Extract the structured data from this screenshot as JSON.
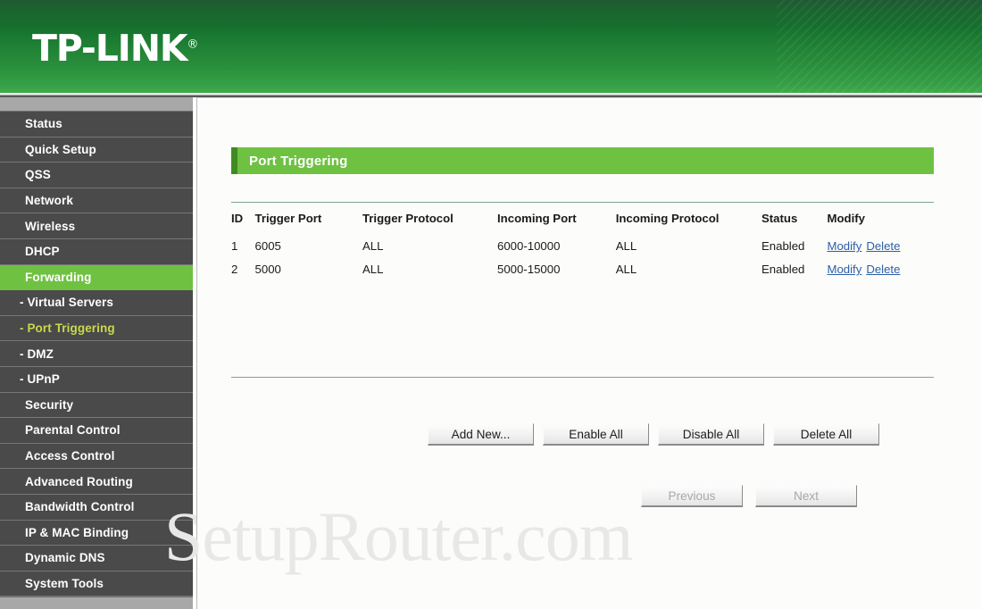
{
  "header": {
    "logo_text": "TP-LINK",
    "logo_registered": "®"
  },
  "sidebar": {
    "items": [
      {
        "label": "Status",
        "state": "normal"
      },
      {
        "label": "Quick Setup",
        "state": "normal"
      },
      {
        "label": "QSS",
        "state": "normal"
      },
      {
        "label": "Network",
        "state": "normal"
      },
      {
        "label": "Wireless",
        "state": "normal"
      },
      {
        "label": "DHCP",
        "state": "normal"
      },
      {
        "label": "Forwarding",
        "state": "active"
      },
      {
        "label": "- Virtual Servers",
        "state": "sub"
      },
      {
        "label": "- Port Triggering",
        "state": "current"
      },
      {
        "label": "- DMZ",
        "state": "sub"
      },
      {
        "label": "- UPnP",
        "state": "sub"
      },
      {
        "label": "Security",
        "state": "normal"
      },
      {
        "label": "Parental Control",
        "state": "normal"
      },
      {
        "label": "Access Control",
        "state": "normal"
      },
      {
        "label": "Advanced Routing",
        "state": "normal"
      },
      {
        "label": "Bandwidth Control",
        "state": "normal"
      },
      {
        "label": "IP & MAC Binding",
        "state": "normal"
      },
      {
        "label": "Dynamic DNS",
        "state": "normal"
      },
      {
        "label": "System Tools",
        "state": "normal"
      }
    ]
  },
  "main": {
    "page_title": "Port Triggering",
    "table": {
      "columns": [
        "ID",
        "Trigger Port",
        "Trigger Protocol",
        "Incoming Port",
        "Incoming Protocol",
        "Status",
        "Modify"
      ],
      "rows": [
        {
          "id": "1",
          "trigger_port": "6005",
          "trigger_protocol": "ALL",
          "incoming_port": "6000-10000",
          "incoming_protocol": "ALL",
          "status": "Enabled",
          "modify_link": "Modify",
          "delete_link": "Delete"
        },
        {
          "id": "2",
          "trigger_port": "5000",
          "trigger_protocol": "ALL",
          "incoming_port": "5000-15000",
          "incoming_protocol": "ALL",
          "status": "Enabled",
          "modify_link": "Modify",
          "delete_link": "Delete"
        }
      ]
    },
    "actions": {
      "add_new": "Add New...",
      "enable_all": "Enable All",
      "disable_all": "Disable All",
      "delete_all": "Delete All"
    },
    "pagination": {
      "previous": "Previous",
      "next": "Next"
    }
  },
  "watermark": {
    "text": "SetupRouter.com"
  },
  "colors": {
    "brand_green": "#6fc142",
    "header_dark_green": "#0d4d22",
    "sidebar_bg": "#4a4a4a",
    "current_item": "#c9d94a",
    "link_blue": "#2d5fa8",
    "rule": "#7ea39c"
  }
}
